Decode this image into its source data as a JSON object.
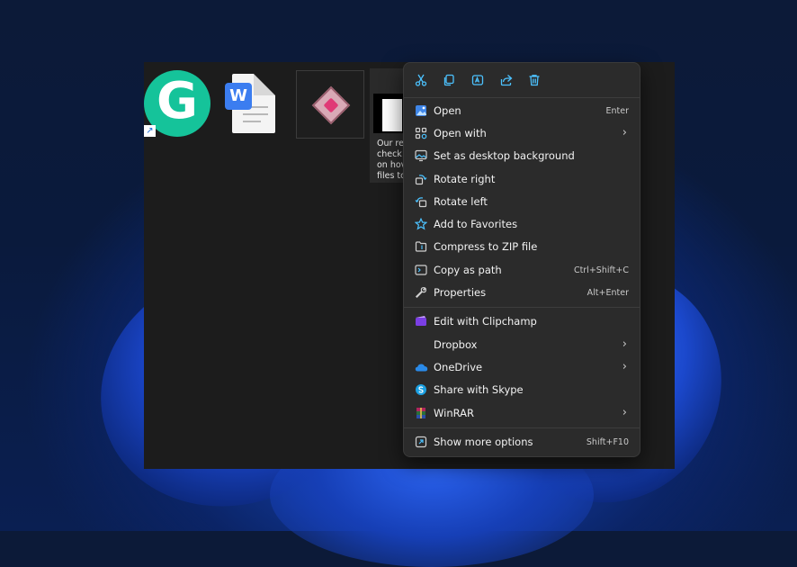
{
  "explorer": {
    "files": [
      {
        "name": "grammarly-icon",
        "glyph": "G",
        "shortcut_glyph": "↗"
      },
      {
        "name": "wps-document-icon",
        "glyph": "W"
      },
      {
        "name": "gem-app-icon"
      },
      {
        "name": "text-document-tile",
        "caption_lines": [
          "Our rea",
          "check c",
          "on hov",
          "files to"
        ]
      }
    ]
  },
  "context_menu": {
    "toolbar": [
      {
        "id": "cut",
        "icon": "scissors-icon"
      },
      {
        "id": "copy",
        "icon": "copy-icon"
      },
      {
        "id": "rename",
        "icon": "rename-icon"
      },
      {
        "id": "share",
        "icon": "share-icon"
      },
      {
        "id": "delete",
        "icon": "trash-icon"
      }
    ],
    "items": [
      {
        "label": "Open",
        "shortcut": "Enter",
        "icon": "image-open-icon"
      },
      {
        "label": "Open with",
        "submenu": "›",
        "icon": "open-with-icon"
      },
      {
        "label": "Set as desktop background",
        "icon": "desktop-background-icon"
      },
      {
        "label": "Rotate right",
        "icon": "rotate-right-icon"
      },
      {
        "label": "Rotate left",
        "icon": "rotate-left-icon"
      },
      {
        "label": "Add to Favorites",
        "icon": "star-icon"
      },
      {
        "label": "Compress to ZIP file",
        "icon": "zip-folder-icon"
      },
      {
        "label": "Copy as path",
        "shortcut": "Ctrl+Shift+C",
        "icon": "copy-path-icon"
      },
      {
        "label": "Properties",
        "shortcut": "Alt+Enter",
        "icon": "wrench-icon"
      },
      {
        "label": "Edit with Clipchamp",
        "icon": "clipchamp-icon"
      },
      {
        "label": "Dropbox",
        "submenu": "›",
        "icon": ""
      },
      {
        "label": "OneDrive",
        "submenu": "›",
        "icon": "onedrive-cloud-icon"
      },
      {
        "label": "Share with Skype",
        "icon": "skype-icon"
      },
      {
        "label": "WinRAR",
        "submenu": "›",
        "icon": "winrar-icon"
      },
      {
        "label": "Show more options",
        "shortcut": "Shift+F10",
        "icon": "more-options-icon"
      }
    ]
  },
  "colors": {
    "menu_bg": "#2b2b2b",
    "explorer_bg": "#1c1c1c",
    "accent_blue": "#4cc2ff",
    "grammarly_green": "#15c39a"
  }
}
